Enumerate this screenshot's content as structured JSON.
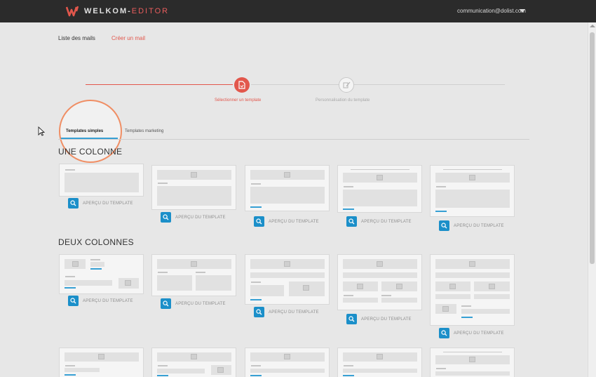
{
  "app": {
    "brand_main": "WELKOM-",
    "brand_sub": "EDITOR",
    "user_email": "communication@dolist.com"
  },
  "nav": {
    "list_label": "Liste des mails",
    "create_label": "Créer un mail"
  },
  "stepper": {
    "step1_label": "Sélectionner un template",
    "step2_label": "Personnalisation du template"
  },
  "tabs": {
    "simple_label": "Templates simples",
    "marketing_label": "Templates marketing"
  },
  "sections": {
    "one_column": "UNE COLONNE",
    "two_columns": "DEUX COLONNES"
  },
  "preview_label": "APERÇU DU TEMPLATE",
  "colors": {
    "accent_red": "#e2574c",
    "accent_blue": "#37a0d4",
    "button_blue": "#1b8fc9",
    "topbar": "#2b2b2b",
    "highlight_ring": "#f08e64"
  }
}
